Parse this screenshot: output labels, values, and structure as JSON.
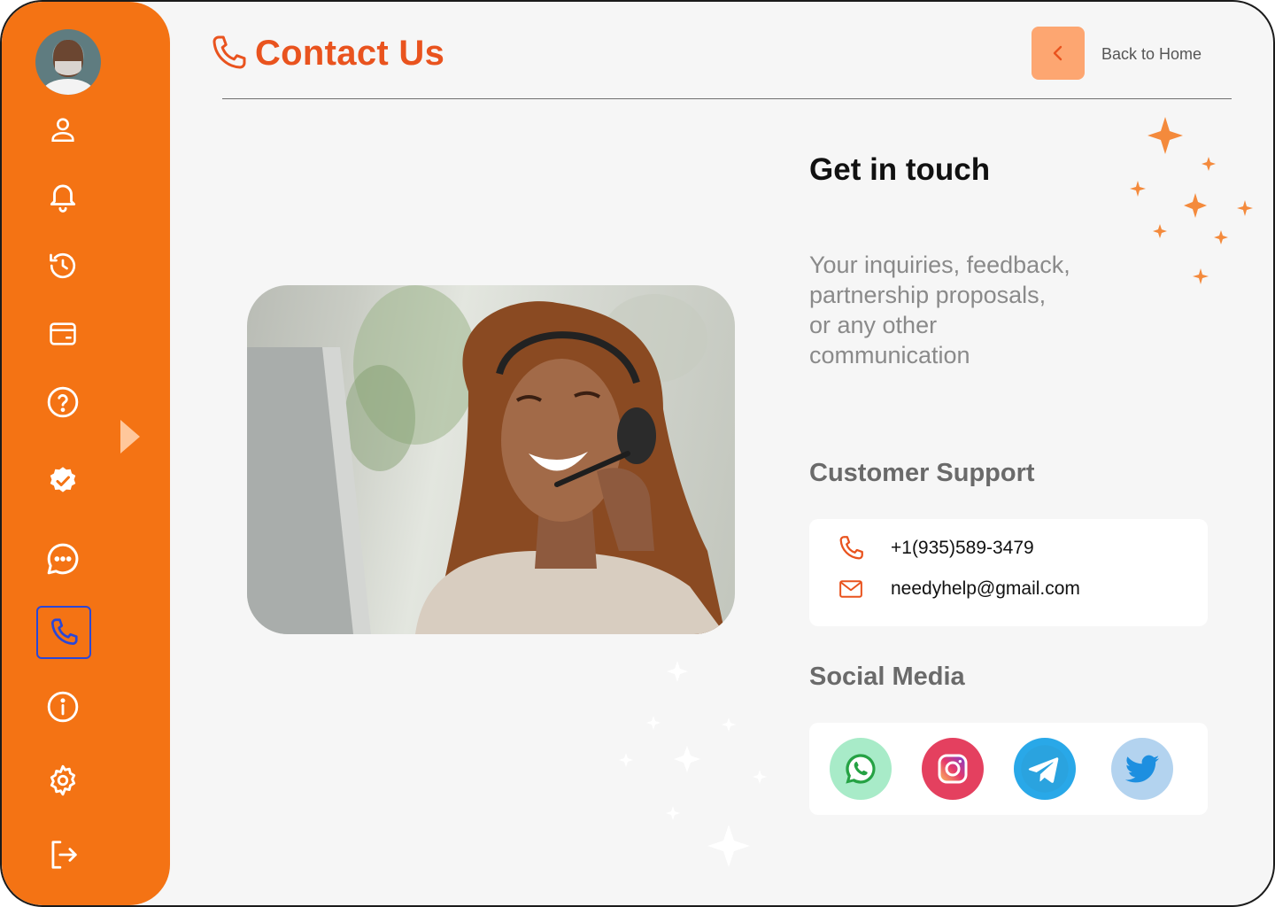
{
  "header": {
    "title": "Contact Us",
    "back_label": "Back to Home"
  },
  "sidebar": {
    "items": [
      {
        "icon": "user-icon",
        "active": false
      },
      {
        "icon": "bell-icon",
        "active": false
      },
      {
        "icon": "history-icon",
        "active": false
      },
      {
        "icon": "wallet-icon",
        "active": false
      },
      {
        "icon": "help-icon",
        "active": false
      },
      {
        "icon": "verified-badge-icon",
        "active": false
      },
      {
        "icon": "chat-icon",
        "active": false
      },
      {
        "icon": "phone-icon",
        "active": true
      },
      {
        "icon": "info-icon",
        "active": false
      },
      {
        "icon": "settings-icon",
        "active": false
      },
      {
        "icon": "logout-icon",
        "active": false
      }
    ]
  },
  "main": {
    "heading": "Get in touch",
    "intro_lines": [
      "Your inquiries, feedback,",
      "partnership proposals,",
      "or any other",
      "communication"
    ]
  },
  "support": {
    "title": "Customer Support",
    "phone": "+1(935)589-3479",
    "email": "needyhelp@gmail.com"
  },
  "social": {
    "title": "Social Media",
    "items": [
      {
        "icon": "whatsapp-icon",
        "color": "#a8ebc8"
      },
      {
        "icon": "instagram-icon",
        "color": "#e4405f"
      },
      {
        "icon": "telegram-icon",
        "color": "#29a8e8"
      },
      {
        "icon": "twitter-icon",
        "color": "#b3d3ef"
      }
    ]
  },
  "colors": {
    "sidebar": "#f47314",
    "accent": "#e9531e",
    "back_button": "#fda671",
    "sparkle": "#f48a3c"
  }
}
